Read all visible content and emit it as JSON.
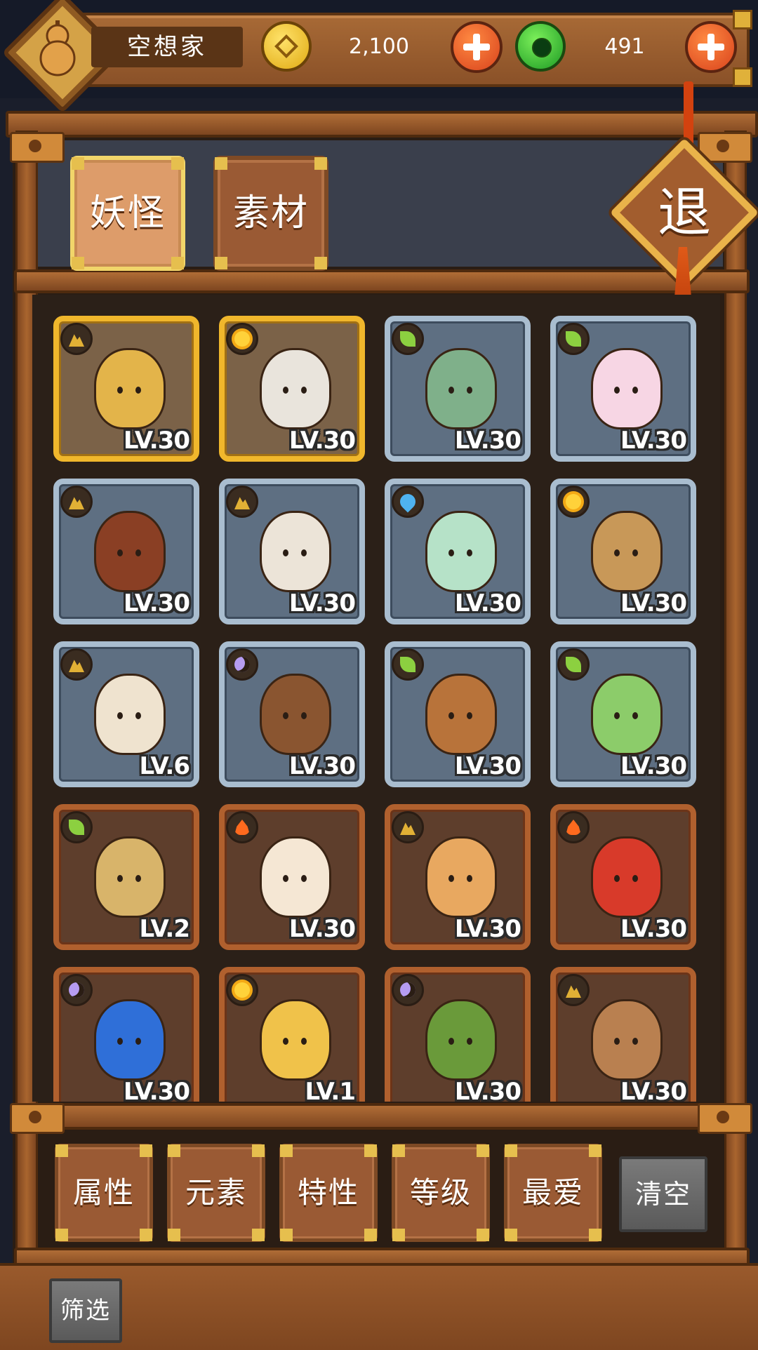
{
  "player": {
    "name": "空想家"
  },
  "currency": {
    "coins": {
      "icon": "gold-coin-icon",
      "value": "2,100"
    },
    "jade": {
      "icon": "jade-coin-icon",
      "value": "491"
    }
  },
  "tabs": [
    {
      "label": "妖怪",
      "active": true
    },
    {
      "label": "素材",
      "active": false
    }
  ],
  "exit": {
    "label": "退"
  },
  "items": [
    {
      "element": "earth",
      "frame": "gold",
      "level": "LV.30",
      "creature": "monkey-charm",
      "color": "#e3b44a"
    },
    {
      "element": "sun",
      "frame": "gold",
      "level": "LV.30",
      "creature": "white-pig",
      "color": "#e9e4dc"
    },
    {
      "element": "leaf",
      "frame": "blue",
      "level": "LV.30",
      "creature": "green-fish",
      "color": "#7fb08a"
    },
    {
      "element": "leaf",
      "frame": "blue",
      "level": "LV.30",
      "creature": "flower-sprite",
      "color": "#f7d6e4"
    },
    {
      "element": "earth",
      "frame": "blue",
      "level": "LV.30",
      "creature": "clay-bell",
      "color": "#8a3f24"
    },
    {
      "element": "earth",
      "frame": "blue",
      "level": "LV.30",
      "creature": "bone-rattle",
      "color": "#ece4d8"
    },
    {
      "element": "water",
      "frame": "blue",
      "level": "LV.30",
      "creature": "jade-sword",
      "color": "#b6e2c8"
    },
    {
      "element": "sun",
      "frame": "blue",
      "level": "LV.30",
      "creature": "wooden-stocks",
      "color": "#c89858"
    },
    {
      "element": "earth",
      "frame": "blue",
      "level": "LV.6",
      "creature": "old-scholar",
      "color": "#efe3cf"
    },
    {
      "element": "moon",
      "frame": "blue",
      "level": "LV.30",
      "creature": "treasure-chest",
      "color": "#8a5530"
    },
    {
      "element": "leaf",
      "frame": "blue",
      "level": "LV.30",
      "creature": "root-sprout",
      "color": "#b8733a"
    },
    {
      "element": "leaf",
      "frame": "blue",
      "level": "LV.30",
      "creature": "leaf-girl",
      "color": "#8ccc6a"
    },
    {
      "element": "leaf",
      "frame": "brown",
      "level": "LV.2",
      "creature": "hourglass",
      "color": "#d8b46a"
    },
    {
      "element": "fire",
      "frame": "brown",
      "level": "LV.30",
      "creature": "egg-bowl",
      "color": "#f5e7d4"
    },
    {
      "element": "earth",
      "frame": "brown",
      "level": "LV.30",
      "creature": "tofu-roll",
      "color": "#e8a860"
    },
    {
      "element": "fire",
      "frame": "brown",
      "level": "LV.30",
      "creature": "paint-bucket",
      "color": "#d83a2a"
    },
    {
      "element": "moon",
      "frame": "brown",
      "level": "LV.30",
      "creature": "blue-cake",
      "color": "#2f6fd8"
    },
    {
      "element": "sun",
      "frame": "brown",
      "level": "LV.1",
      "creature": "tiger-boy",
      "color": "#f0c24a"
    },
    {
      "element": "moon",
      "frame": "brown",
      "level": "LV.30",
      "creature": "leaf-eyeball",
      "color": "#6a9a3a"
    },
    {
      "element": "earth",
      "frame": "brown",
      "level": "LV.30",
      "creature": "monkey-ball",
      "color": "#b98050"
    }
  ],
  "filters": [
    {
      "label": "属性"
    },
    {
      "label": "元素"
    },
    {
      "label": "特性"
    },
    {
      "label": "等级"
    },
    {
      "label": "最爱"
    }
  ],
  "clear_label": "清空",
  "filter_toggle_label": "筛选"
}
